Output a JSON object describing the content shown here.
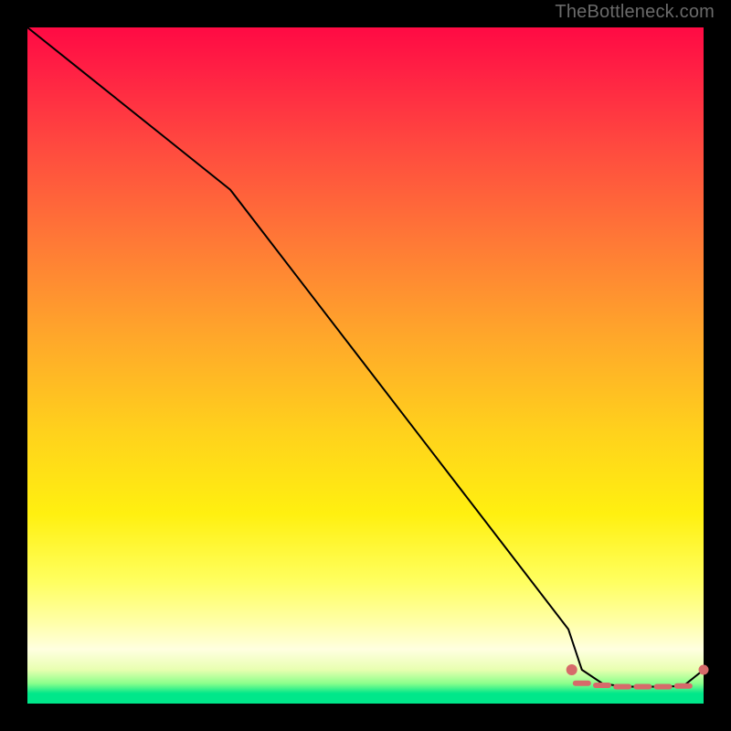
{
  "watermark": "TheBottleneck.com",
  "chart_data": {
    "type": "line",
    "title": "",
    "xlabel": "",
    "ylabel": "",
    "xlim": [
      0,
      100
    ],
    "ylim": [
      0,
      100
    ],
    "grid": false,
    "series": [
      {
        "name": "curve",
        "x": [
          0,
          10,
          20,
          30,
          40,
          50,
          60,
          70,
          80,
          82,
          85,
          88,
          91,
          94,
          97,
          100
        ],
        "y": [
          100,
          92,
          84,
          76,
          63,
          50,
          37,
          24,
          11,
          5,
          3,
          2.5,
          2.5,
          2.5,
          2.6,
          5
        ]
      }
    ],
    "markers": {
      "dashes_x": [
        82,
        85,
        88,
        91,
        94,
        97
      ],
      "dashes_y": [
        3,
        2.7,
        2.5,
        2.5,
        2.5,
        2.6
      ],
      "end_dot": {
        "x": 100,
        "y": 5
      },
      "start_cluster": {
        "x": 80.5,
        "y": 5
      }
    },
    "colors": {
      "curve": "#000000",
      "marker": "#d66a6a",
      "gradient_top": "#ff0a44",
      "gradient_mid": "#fff010",
      "gradient_bottom": "#00e78a",
      "frame": "#000000"
    }
  }
}
